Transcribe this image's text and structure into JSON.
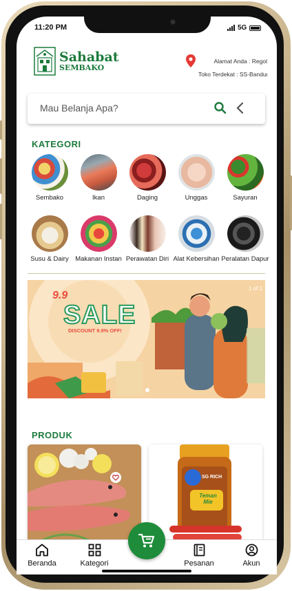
{
  "status": {
    "time": "11:20 PM",
    "network": "5G"
  },
  "header": {
    "brand_name": "Sahabat",
    "brand_sub": "SEMBAKO",
    "address_line1": "Alamat Anda : Regol",
    "address_line2": "Toko Terdekat : SS-Bandung"
  },
  "search": {
    "placeholder": "Mau Belanja Apa?"
  },
  "categories": {
    "title": "KATEGORI",
    "items": [
      {
        "label": "Sembako",
        "icon": "groceries-photo"
      },
      {
        "label": "Ikan",
        "icon": "fish-photo"
      },
      {
        "label": "Daging",
        "icon": "meat-photo"
      },
      {
        "label": "Unggas",
        "icon": "poultry-photo"
      },
      {
        "label": "Sayuran",
        "icon": "vegetables-photo"
      },
      {
        "label": "Susu & Dairy",
        "icon": "dairy-photo"
      },
      {
        "label": "Makanan Instan",
        "icon": "instant-food-photo"
      },
      {
        "label": "Perawatan Diri",
        "icon": "personal-care-photo"
      },
      {
        "label": "Alat Kebersihan",
        "icon": "cleaning-tools-photo"
      },
      {
        "label": "Peralatan Dapur",
        "icon": "kitchenware-photo"
      }
    ]
  },
  "banner": {
    "counter": "1 of 1",
    "pre": "9.9",
    "headline": "SALE",
    "discount": "DISCOUNT 9.9% OFF!"
  },
  "products": {
    "title": "PRODUK",
    "items": [
      {
        "image": "red-snapper-fish-photo"
      },
      {
        "image": "teman-mie-jar-photo",
        "jar_brand": "SG RICH",
        "jar_label": "Teman Mie"
      }
    ]
  },
  "nav": {
    "home": "Beranda",
    "categories": "Kategori",
    "orders": "Pesanan",
    "account": "Akun"
  },
  "colors": {
    "brand_green": "#1c7a3c",
    "fab_green": "#1e8c3a",
    "pin_red": "#e53935"
  }
}
